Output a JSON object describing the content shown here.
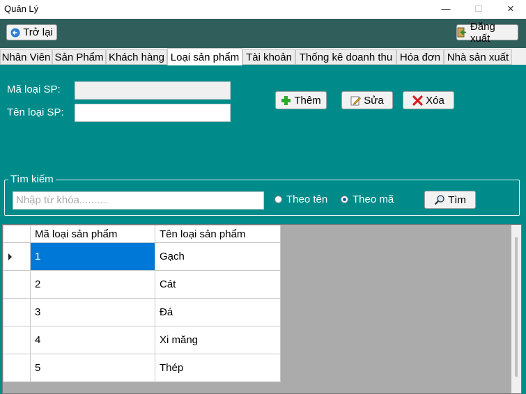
{
  "window": {
    "title": "Quản Lý",
    "minimize_icon": "minimize-icon",
    "maximize_icon": "maximize-icon",
    "close_icon": "close-icon"
  },
  "toolbar": {
    "back_label": "Trở lại",
    "logout_label": "Đăng xuất"
  },
  "tabs": [
    {
      "label": "Nhân Viên"
    },
    {
      "label": "Sản Phẩm"
    },
    {
      "label": "Khách hàng"
    },
    {
      "label": "Loại sản phẩm",
      "active": true
    },
    {
      "label": "Tài khoản"
    },
    {
      "label": "Thống kê doanh thu"
    },
    {
      "label": "Hóa đơn"
    },
    {
      "label": "Nhà sản xuất"
    }
  ],
  "form": {
    "code_label": "Mã loại SP:",
    "code_value": "",
    "name_label": "Tên loại SP:",
    "name_value": ""
  },
  "actions": {
    "add_label": "Thêm",
    "edit_label": "Sửa",
    "delete_label": "Xóa"
  },
  "search": {
    "group_title": "Tìm kiếm",
    "placeholder": "Nhập từ khóa..........",
    "by_name_label": "Theo tên",
    "by_code_label": "Theo mã",
    "selected": "Theo mã",
    "button_label": "Tìm"
  },
  "table": {
    "columns": [
      "Mã loại sản phẩm",
      "Tên  loại sản phẩm"
    ],
    "rows": [
      [
        "1",
        "Gạch"
      ],
      [
        "2",
        "Cát"
      ],
      [
        "3",
        "Đá"
      ],
      [
        "4",
        "Xi măng"
      ],
      [
        "5",
        "Thép"
      ]
    ],
    "selected_row": 0
  },
  "colors": {
    "background": "#008b8b",
    "topbar": "#2f5e5b",
    "selection": "#0078d7"
  }
}
